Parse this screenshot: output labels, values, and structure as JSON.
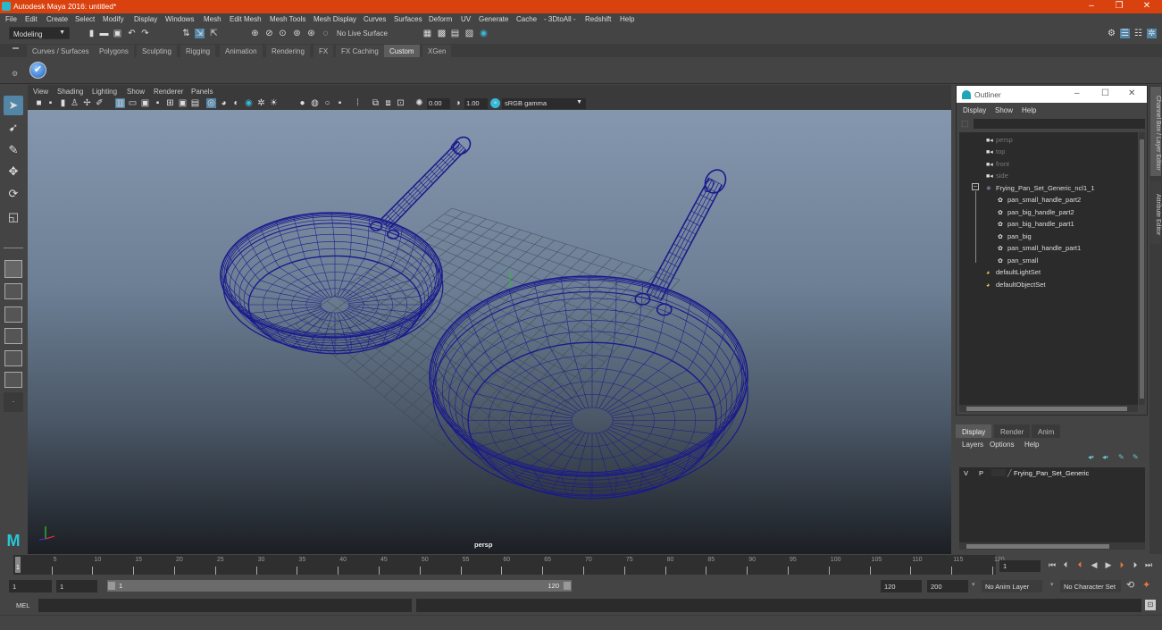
{
  "window": {
    "title": "Autodesk Maya 2016: untitled*",
    "controls": {
      "minimize": "–",
      "maximize": "❐",
      "close": "✕"
    }
  },
  "menubar": [
    "File",
    "Edit",
    "Create",
    "Select",
    "Modify",
    "Display",
    "Windows",
    "Mesh",
    "Edit Mesh",
    "Mesh Tools",
    "Mesh Display",
    "Curves",
    "Surfaces",
    "Deform",
    "UV",
    "Generate",
    "Cache",
    "- 3DtoAll -",
    "Redshift",
    "Help"
  ],
  "statusline": {
    "mode": "Modeling",
    "live_surface": "No Live Surface"
  },
  "shelf": {
    "tabs": [
      "Curves / Surfaces",
      "Polygons",
      "Sculpting",
      "Rigging",
      "Animation",
      "Rendering",
      "FX",
      "FX Caching",
      "Custom",
      "XGen"
    ],
    "active_tab": "Custom"
  },
  "viewport": {
    "menu": [
      "View",
      "Shading",
      "Lighting",
      "Show",
      "Renderer",
      "Panels"
    ],
    "exposure": "0.00",
    "gamma": "1.00",
    "color_space": "sRGB gamma",
    "camera_label": "persp",
    "wire_color": "#1a1a8c"
  },
  "outliner": {
    "title": "Outliner",
    "menu": [
      "Display",
      "Show",
      "Help"
    ],
    "items": [
      {
        "label": "persp",
        "icon": "camera-icon",
        "dim": true,
        "indent": 0
      },
      {
        "label": "top",
        "icon": "camera-icon",
        "dim": true,
        "indent": 0
      },
      {
        "label": "front",
        "icon": "camera-icon",
        "dim": true,
        "indent": 0
      },
      {
        "label": "side",
        "icon": "camera-icon",
        "dim": true,
        "indent": 0
      },
      {
        "label": "Frying_Pan_Set_Generic_ncl1_1",
        "icon": "group-icon",
        "dim": false,
        "indent": 0,
        "expanded": true
      },
      {
        "label": "pan_small_handle_part2",
        "icon": "mesh-icon",
        "dim": false,
        "indent": 1
      },
      {
        "label": "pan_big_handle_part2",
        "icon": "mesh-icon",
        "dim": false,
        "indent": 1
      },
      {
        "label": "pan_big_handle_part1",
        "icon": "mesh-icon",
        "dim": false,
        "indent": 1
      },
      {
        "label": "pan_big",
        "icon": "mesh-icon",
        "dim": false,
        "indent": 1
      },
      {
        "label": "pan_small_handle_part1",
        "icon": "mesh-icon",
        "dim": false,
        "indent": 1
      },
      {
        "label": "pan_small",
        "icon": "mesh-icon",
        "dim": false,
        "indent": 1
      },
      {
        "label": "defaultLightSet",
        "icon": "set-icon",
        "dim": false,
        "indent": 0
      },
      {
        "label": "defaultObjectSet",
        "icon": "set-icon",
        "dim": false,
        "indent": 0
      }
    ]
  },
  "sidetabs": [
    "Channel Box / Layer Editor",
    "Attribute Editor"
  ],
  "layer_editor": {
    "tabs": [
      "Display",
      "Render",
      "Anim"
    ],
    "active_tab": "Display",
    "menu": [
      "Layers",
      "Options",
      "Help"
    ],
    "layers": [
      {
        "v": "V",
        "p": "P",
        "name": "Frying_Pan_Set_Generic"
      }
    ]
  },
  "timeline": {
    "ticks": [
      5,
      10,
      15,
      20,
      25,
      30,
      35,
      40,
      45,
      50,
      55,
      60,
      65,
      70,
      75,
      80,
      85,
      90,
      95,
      100,
      105,
      110,
      115,
      120
    ],
    "range_start": 1,
    "range_end": 120,
    "current_frame": "1",
    "current_marker": "1"
  },
  "range": {
    "start_field": "1",
    "start2_field": "1",
    "slider_start": "1",
    "slider_end": "120",
    "end_field": "120",
    "end2_field": "200",
    "anim_layer": "No Anim Layer",
    "character_set": "No Character Set"
  },
  "command_line": {
    "language": "MEL"
  }
}
